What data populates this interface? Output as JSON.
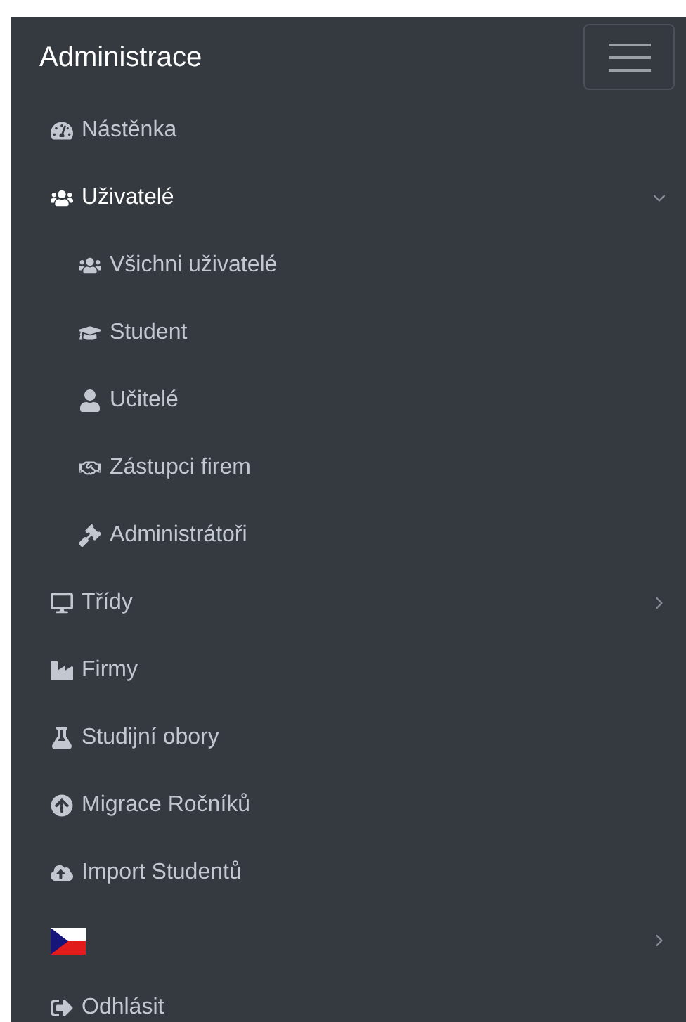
{
  "brand": {
    "title": "Administrace"
  },
  "menu": [
    {
      "kind": "link",
      "label": "Nástěnka"
    },
    {
      "kind": "group",
      "label": "Uživatelé",
      "expanded": true,
      "children": [
        {
          "label": "Všichni uživatelé"
        },
        {
          "label": "Student"
        },
        {
          "label": "Učitelé"
        },
        {
          "label": "Zástupci firem"
        },
        {
          "label": "Administrátoři"
        }
      ]
    },
    {
      "kind": "group",
      "label": "Třídy",
      "expanded": false
    },
    {
      "kind": "link",
      "label": "Firmy"
    },
    {
      "kind": "link",
      "label": "Studijní obory"
    },
    {
      "kind": "link",
      "label": "Migrace Ročníků"
    },
    {
      "kind": "link",
      "label": "Import Studentů"
    },
    {
      "kind": "flag",
      "expanded": false
    },
    {
      "kind": "link",
      "label": "Odhlásit"
    }
  ]
}
